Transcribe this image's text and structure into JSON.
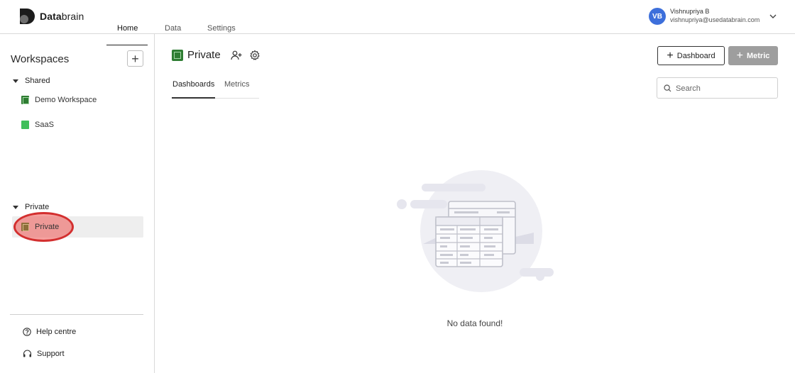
{
  "brand": {
    "name_bold": "Data",
    "name_light": "brain"
  },
  "topnav": {
    "items": [
      {
        "label": "Home"
      },
      {
        "label": "Data"
      },
      {
        "label": "Settings"
      }
    ]
  },
  "user": {
    "initials": "VB",
    "name": "Vishnupriya B",
    "email": "vishnupriya@usedatabrain.com",
    "avatar_color": "#3d6fdb"
  },
  "sidebar": {
    "title": "Workspaces",
    "add_symbol": "+",
    "groups": [
      {
        "label": "Shared",
        "items": [
          {
            "label": "Demo Workspace",
            "icon": "sheet-icon"
          },
          {
            "label": "SaaS",
            "icon": "file-icon"
          }
        ]
      },
      {
        "label": "Private",
        "items": [
          {
            "label": "Private",
            "icon": "sheet-icon"
          }
        ]
      }
    ],
    "footer": [
      {
        "label": "Help centre",
        "icon": "help-icon"
      },
      {
        "label": "Support",
        "icon": "headset-icon"
      }
    ]
  },
  "main": {
    "title": "Private",
    "tabs": [
      {
        "label": "Dashboards"
      },
      {
        "label": "Metrics"
      }
    ],
    "buttons": {
      "dashboard": "Dashboard",
      "metric": "Metric",
      "plus": "+"
    },
    "search": {
      "placeholder": "Search",
      "value": ""
    },
    "empty_text": "No data found!"
  },
  "colors": {
    "accent": "#3d6fdb",
    "highlight": "#d32f2f",
    "metric_button": "#9e9e9e"
  }
}
